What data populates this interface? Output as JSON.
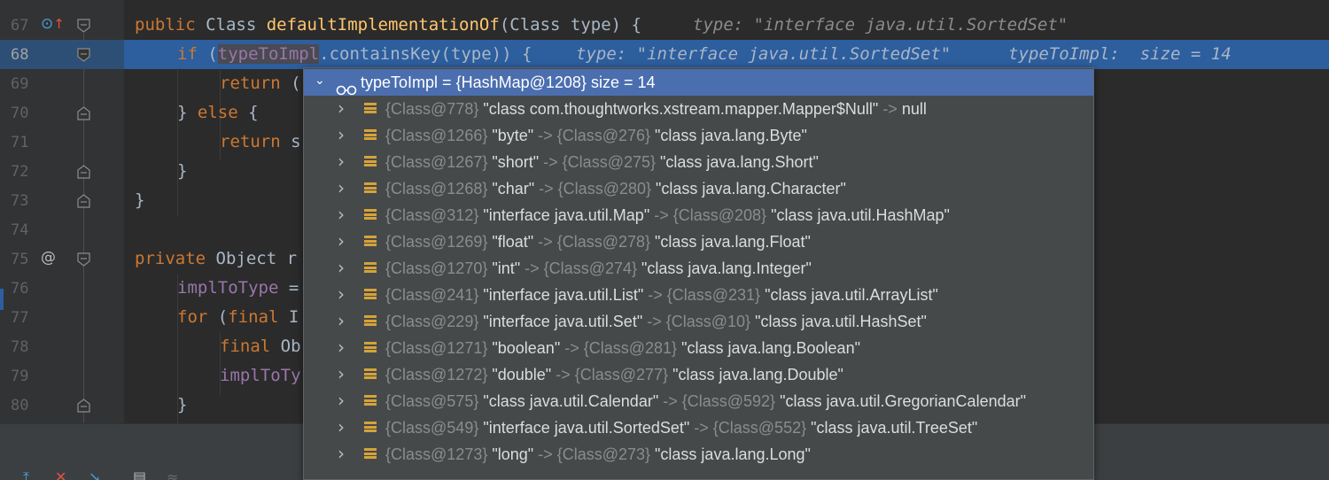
{
  "gutter": {
    "lines": [
      {
        "num": "67",
        "icon": "override"
      },
      {
        "num": "68",
        "icon": ""
      },
      {
        "num": "69",
        "icon": ""
      },
      {
        "num": "70",
        "icon": ""
      },
      {
        "num": "71",
        "icon": ""
      },
      {
        "num": "72",
        "icon": ""
      },
      {
        "num": "73",
        "icon": ""
      },
      {
        "num": "74",
        "icon": ""
      },
      {
        "num": "75",
        "icon": "at"
      },
      {
        "num": "76",
        "icon": ""
      },
      {
        "num": "77",
        "icon": ""
      },
      {
        "num": "78",
        "icon": ""
      },
      {
        "num": "79",
        "icon": ""
      },
      {
        "num": "80",
        "icon": ""
      }
    ],
    "at_symbol": "@"
  },
  "code": {
    "l67": {
      "kw1": "public ",
      "t1": "Class ",
      "fn": "defaultImplementationOf",
      "t2": "(Class type) {",
      "hint": "type: \"interface java.util.SortedSet\""
    },
    "l68": {
      "kw": "if ",
      "p1": "(",
      "field": "typeToImpl",
      "t2": ".containsKey(type)) {",
      "hint1": "type: \"interface java.util.SortedSet\"",
      "hint2": "typeToImpl:  size = 14"
    },
    "l69": {
      "kw": "return ",
      "t": "("
    },
    "l70": {
      "t1": "} ",
      "kw": "else",
      "t2": " {"
    },
    "l71": {
      "kw": "return ",
      "t": "s"
    },
    "l72": {
      "t": "}"
    },
    "l73": {
      "t": "}"
    },
    "l75": {
      "kw": "private ",
      "t1": "Object ",
      "t2": "r"
    },
    "l76": {
      "field": "implToType",
      "t": " ="
    },
    "l77": {
      "kw1": "for ",
      "t1": "(",
      "kw2": "final ",
      "t2": "I"
    },
    "l78": {
      "kw": "final ",
      "t": "Ob"
    },
    "l79": {
      "field": "implToTy"
    },
    "l80": {
      "t": "}"
    }
  },
  "popup": {
    "header": {
      "name": "typeToImpl",
      "eq": " = ",
      "type": "{HashMap@1208}",
      "size": "  size = 14"
    },
    "entries": [
      {
        "k_id": "{Class@778}",
        "k_val": " \"class com.thoughtworks.xstream.mapper.Mapper$Null\"",
        "arrow": " -> ",
        "v_id": "",
        "v_val": "null"
      },
      {
        "k_id": "{Class@1266}",
        "k_val": " \"byte\"",
        "arrow": " -> ",
        "v_id": "{Class@276}",
        "v_val": " \"class java.lang.Byte\""
      },
      {
        "k_id": "{Class@1267}",
        "k_val": " \"short\"",
        "arrow": " -> ",
        "v_id": "{Class@275}",
        "v_val": " \"class java.lang.Short\""
      },
      {
        "k_id": "{Class@1268}",
        "k_val": " \"char\"",
        "arrow": " -> ",
        "v_id": "{Class@280}",
        "v_val": " \"class java.lang.Character\""
      },
      {
        "k_id": "{Class@312}",
        "k_val": " \"interface java.util.Map\"",
        "arrow": " -> ",
        "v_id": "{Class@208}",
        "v_val": " \"class java.util.HashMap\""
      },
      {
        "k_id": "{Class@1269}",
        "k_val": " \"float\"",
        "arrow": " -> ",
        "v_id": "{Class@278}",
        "v_val": " \"class java.lang.Float\""
      },
      {
        "k_id": "{Class@1270}",
        "k_val": " \"int\"",
        "arrow": " -> ",
        "v_id": "{Class@274}",
        "v_val": " \"class java.lang.Integer\""
      },
      {
        "k_id": "{Class@241}",
        "k_val": " \"interface java.util.List\"",
        "arrow": " -> ",
        "v_id": "{Class@231}",
        "v_val": " \"class java.util.ArrayList\""
      },
      {
        "k_id": "{Class@229}",
        "k_val": " \"interface java.util.Set\"",
        "arrow": " -> ",
        "v_id": "{Class@10}",
        "v_val": " \"class java.util.HashSet\""
      },
      {
        "k_id": "{Class@1271}",
        "k_val": " \"boolean\"",
        "arrow": " -> ",
        "v_id": "{Class@281}",
        "v_val": " \"class java.lang.Boolean\""
      },
      {
        "k_id": "{Class@1272}",
        "k_val": " \"double\"",
        "arrow": " -> ",
        "v_id": "{Class@277}",
        "v_val": " \"class java.lang.Double\""
      },
      {
        "k_id": "{Class@575}",
        "k_val": " \"class java.util.Calendar\"",
        "arrow": " -> ",
        "v_id": "{Class@592}",
        "v_val": " \"class java.util.GregorianCalendar\""
      },
      {
        "k_id": "{Class@549}",
        "k_val": " \"interface java.util.SortedSet\"",
        "arrow": " -> ",
        "v_id": "{Class@552}",
        "v_val": " \"class java.util.TreeSet\""
      },
      {
        "k_id": "{Class@1273}",
        "k_val": " \"long\"",
        "arrow": " -> ",
        "v_id": "{Class@273}",
        "v_val": " \"class java.lang.Long\""
      }
    ]
  },
  "icons": {
    "chevron_right": "›",
    "chevron_down": "⌄"
  },
  "colors": {
    "selection": "#4b6eaf",
    "current_line": "#2d5e9e",
    "keyword": "#cc7832",
    "function": "#ffc66d",
    "field": "#9876aa"
  }
}
